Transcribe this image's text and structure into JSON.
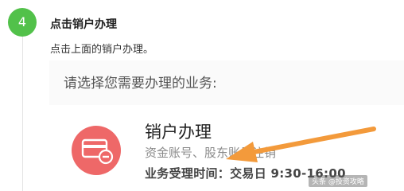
{
  "step": {
    "number": "4",
    "title": "点击销户办理",
    "description": "点击上面的销户办理。"
  },
  "screenshot": {
    "prompt": "请选择您需要办理的业务:",
    "card": {
      "icon": "card-remove-icon",
      "title": "销户办理",
      "subtitle": "资金账号、股东账号注销",
      "hours": "业务受理时间：交易日 9:30-16:00"
    },
    "annotation": "orange-arrow-icon"
  },
  "watermark": "头条 @投资攻略",
  "colors": {
    "badge": "#52c14a",
    "icon_bg": "#ee6868",
    "arrow": "#f39a3b"
  }
}
